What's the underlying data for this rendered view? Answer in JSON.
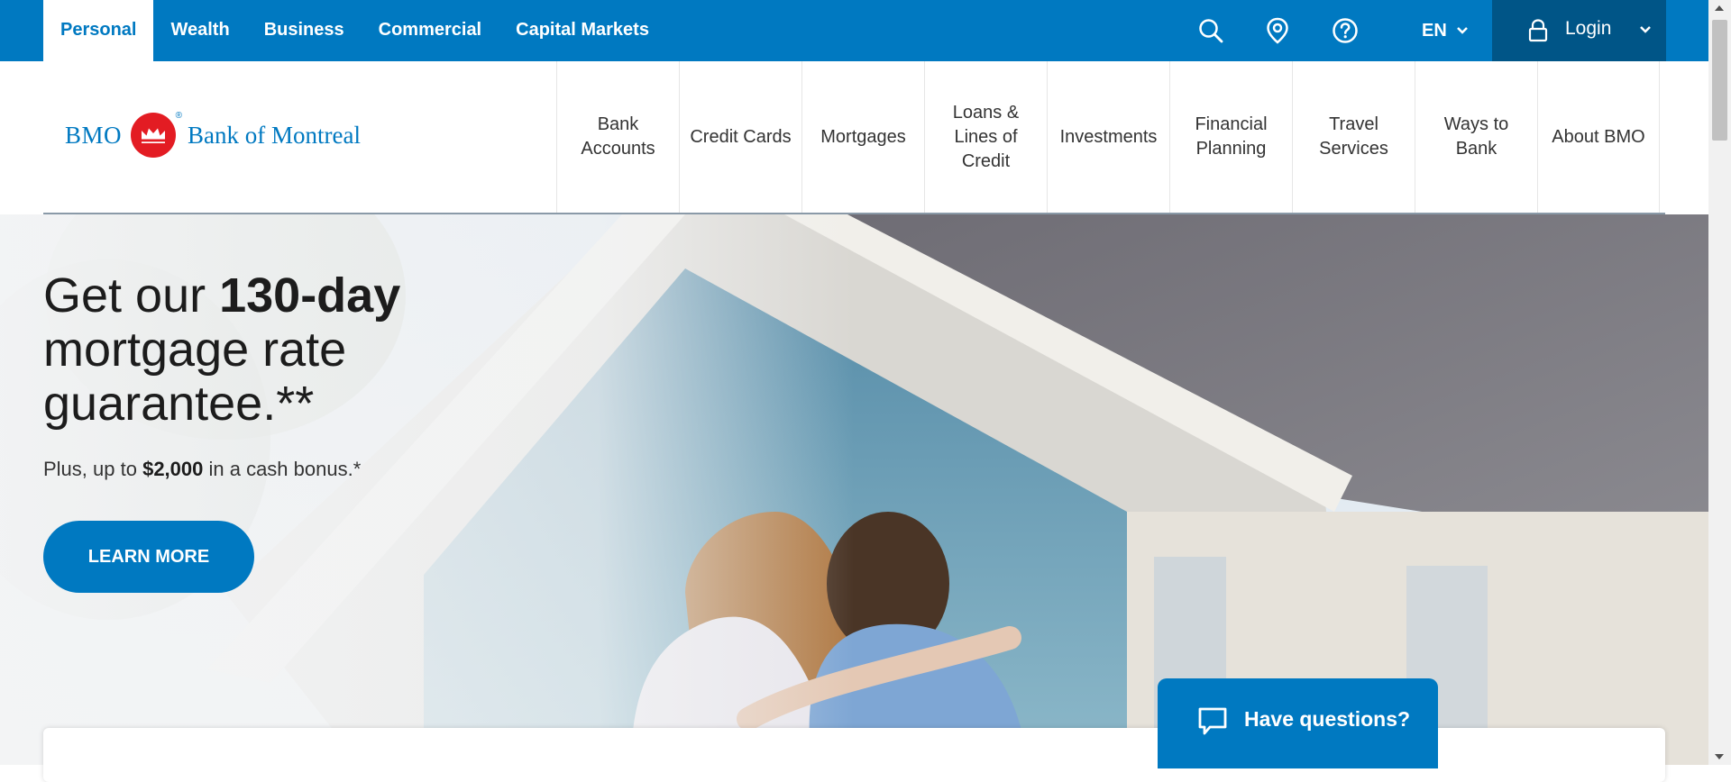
{
  "topbar": {
    "segments": [
      {
        "label": "Personal",
        "active": true
      },
      {
        "label": "Wealth"
      },
      {
        "label": "Business"
      },
      {
        "label": "Commercial"
      },
      {
        "label": "Capital Markets"
      }
    ],
    "icons": [
      "search-icon",
      "location-icon",
      "help-icon"
    ],
    "language": "EN",
    "login_label": "Login"
  },
  "logo": {
    "bmo": "BMO",
    "bank_name": "Bank of Montreal",
    "registered": "®"
  },
  "mainnav": {
    "items": [
      "Bank\nAccounts",
      "Credit Cards",
      "Mortgages",
      "Loans &\nLines of\nCredit",
      "Investments",
      "Financial\nPlanning",
      "Travel\nServices",
      "Ways to\nBank",
      "About BMO"
    ]
  },
  "hero": {
    "headline_pre": "Get our ",
    "headline_bold": "130-day",
    "headline_post": " mortgage rate guarantee.**",
    "sub_pre": "Plus, up to ",
    "sub_bold": "$2,000",
    "sub_post": " in a cash bonus.*",
    "cta": "LEARN MORE"
  },
  "chat": {
    "label": "Have questions?"
  },
  "colors": {
    "brand_blue": "#0079c1",
    "login_dark": "#005587",
    "logo_red": "#e31c23"
  }
}
